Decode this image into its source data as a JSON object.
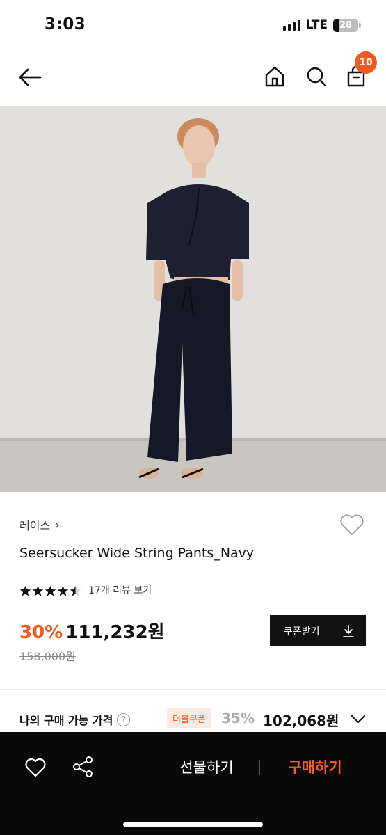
{
  "status": {
    "time": "3:03",
    "network": "LTE",
    "battery": "28"
  },
  "header": {
    "cart_count": "10"
  },
  "product": {
    "brand": "레이스",
    "brand_chevron": "›",
    "name": "Seersucker Wide String Pants_Navy",
    "rating": 4.5,
    "review_link": "17개 리뷰 보기",
    "discount_rate": "30%",
    "sale_price": "111,232원",
    "original_price": "158,000원",
    "coupon_button": "쿠폰받기"
  },
  "my_price": {
    "label": "나의 구매 가능 가격",
    "help": "?",
    "badge": "더블쿠폰",
    "rate": "35%",
    "price": "102,068원"
  },
  "bottom_bar": {
    "gift_label": "선물하기",
    "buy_label": "구매하기"
  },
  "colors": {
    "accent": "#f05a1e",
    "dark": "#0a0a0a",
    "badge_bg": "#fdeae2"
  },
  "icons": [
    "back-arrow-icon",
    "home-icon",
    "search-icon",
    "cart-icon",
    "heart-icon",
    "download-icon",
    "help-icon",
    "chevron-down-icon",
    "share-icon"
  ]
}
